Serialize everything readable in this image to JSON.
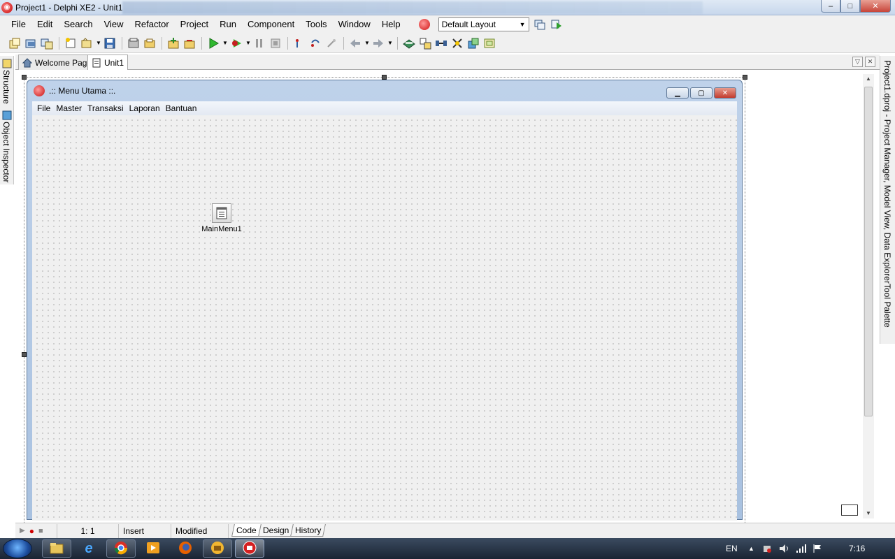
{
  "window": {
    "title": "Project1 - Delphi XE2 - Unit1",
    "minimize": "–",
    "maximize": "□",
    "close": "✕"
  },
  "menu": {
    "items": [
      "File",
      "Edit",
      "Search",
      "View",
      "Refactor",
      "Project",
      "Run",
      "Component",
      "Tools",
      "Window",
      "Help"
    ],
    "layout_value": "Default Layout"
  },
  "left_dock": {
    "structure": "Structure",
    "object_inspector": "Object Inspector"
  },
  "editor_tabs": {
    "welcome": "Welcome Page",
    "unit": "Unit1"
  },
  "form": {
    "caption": ".:: Menu Utama ::.",
    "menu": [
      "File",
      "Master",
      "Transaksi",
      "Laporan",
      "Bantuan"
    ],
    "component_label": "MainMenu1"
  },
  "right_dock": {
    "project": "Project1.dproj - Project Manager, Model View, Data Explorer",
    "palette": "Tool Palette"
  },
  "status": {
    "position": "1:   1",
    "mode": "Insert",
    "state": "Modified",
    "tabs": [
      "Code",
      "Design",
      "History"
    ]
  },
  "taskbar": {
    "language": "EN",
    "clock": "7:16"
  },
  "colors": {
    "title_gradient_top": "#dfe9f5",
    "form_frame": "#a8c1e0",
    "close_red": "#c7453a"
  }
}
